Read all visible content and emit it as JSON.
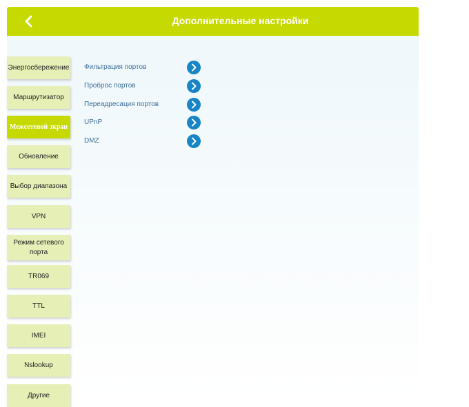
{
  "header": {
    "title": "Дополнительные настройки",
    "back_icon": "chevron-left-icon"
  },
  "sidebar": {
    "items": [
      {
        "label": "Энергосбережение",
        "active": false
      },
      {
        "label": "Маршрутизатор",
        "active": false
      },
      {
        "label": "Межсетевой экран",
        "active": true
      },
      {
        "label": "Обновление",
        "active": false
      },
      {
        "label": "Выбор диапазона",
        "active": false
      },
      {
        "label": "VPN",
        "active": false
      },
      {
        "label": "Режим сетевого порта",
        "active": false
      },
      {
        "label": "TR069",
        "active": false
      },
      {
        "label": "TTL",
        "active": false
      },
      {
        "label": "IMEI",
        "active": false
      },
      {
        "label": "Nslookup",
        "active": false
      },
      {
        "label": "Другие",
        "active": false
      }
    ]
  },
  "main": {
    "rows": [
      {
        "label": "Фильтрация портов",
        "icon": "chevron-right-icon"
      },
      {
        "label": "Проброс портов",
        "icon": "chevron-right-icon"
      },
      {
        "label": "Переадресация портов",
        "icon": "chevron-right-icon"
      },
      {
        "label": "UPnP",
        "icon": "chevron-right-icon"
      },
      {
        "label": "DMZ",
        "icon": "chevron-right-icon"
      }
    ]
  },
  "colors": {
    "accent": "#c6d900",
    "sidebar_item_bg": "#e6efb5",
    "row_button": "#1785c6",
    "row_text": "#3d6d97"
  }
}
